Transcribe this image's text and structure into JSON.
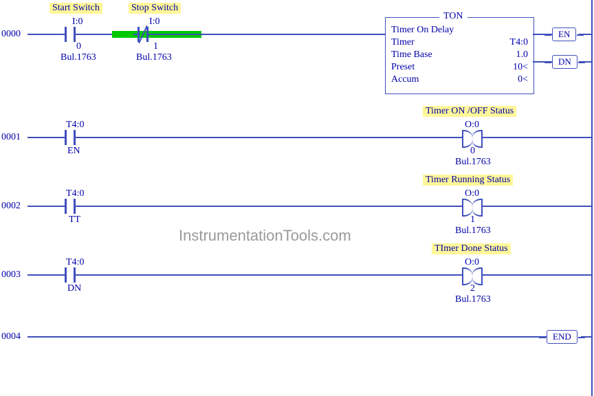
{
  "rungs": {
    "r0": {
      "num": "0000",
      "start": {
        "label": "Start Switch",
        "addr": "I:0",
        "bit": "0",
        "desc": "Bul.1763"
      },
      "stop": {
        "label": "Stop Switch",
        "addr": "I:0",
        "bit": "1",
        "desc": "Bul.1763"
      },
      "ton": {
        "title": "TON",
        "l1": "Timer On Delay",
        "l2a": "Timer",
        "l2b": "T4:0",
        "l3a": "Time Base",
        "l3b": "1.0",
        "l4a": "Preset",
        "l4b": "10<",
        "l5a": "Accum",
        "l5b": "0<",
        "en": "EN",
        "dn": "DN"
      }
    },
    "r1": {
      "num": "0001",
      "in": {
        "addr": "T4:0",
        "sub": "EN"
      },
      "out": {
        "label": "Timer ON /OFF Status",
        "addr": "O:0",
        "bit": "0",
        "desc": "Bul.1763"
      }
    },
    "r2": {
      "num": "0002",
      "in": {
        "addr": "T4:0",
        "sub": "TT"
      },
      "out": {
        "label": "Timer Running Status",
        "addr": "O:0",
        "bit": "1",
        "desc": "Bul.1763"
      }
    },
    "r3": {
      "num": "0003",
      "in": {
        "addr": "T4:0",
        "sub": "DN"
      },
      "out": {
        "label": "TImer Done Status",
        "addr": "O:0",
        "bit": "2",
        "desc": "Bul.1763"
      }
    },
    "r4": {
      "num": "0004",
      "end": "END"
    }
  },
  "watermark": "InstrumentationTools.com"
}
